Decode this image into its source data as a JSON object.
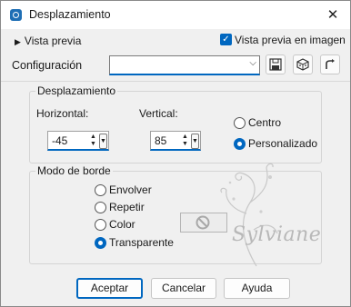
{
  "window": {
    "title": "Desplazamiento"
  },
  "top": {
    "preview_label": "Vista previa",
    "image_preview_label": "Vista previa en imagen",
    "image_preview_checked": true,
    "config_label": "Configuración",
    "config_value": ""
  },
  "offset_group": {
    "title": "Desplazamiento",
    "horizontal_label": "Horizontal:",
    "horizontal_value": "-45",
    "vertical_label": "Vertical:",
    "vertical_value": "85",
    "centro_label": "Centro",
    "personalizado_label": "Personalizado",
    "selected": "Personalizado"
  },
  "edge_group": {
    "title": "Modo de borde",
    "options": [
      "Envolver",
      "Repetir",
      "Color",
      "Transparente"
    ],
    "selected": "Transparente"
  },
  "watermark": {
    "text": "Sylviane"
  },
  "buttons": {
    "ok": "Aceptar",
    "cancel": "Cancelar",
    "help": "Ayuda"
  },
  "icons": [
    "app-icon",
    "close-icon",
    "save-icon",
    "randomize-icon",
    "reset-icon",
    "no-color-icon"
  ]
}
